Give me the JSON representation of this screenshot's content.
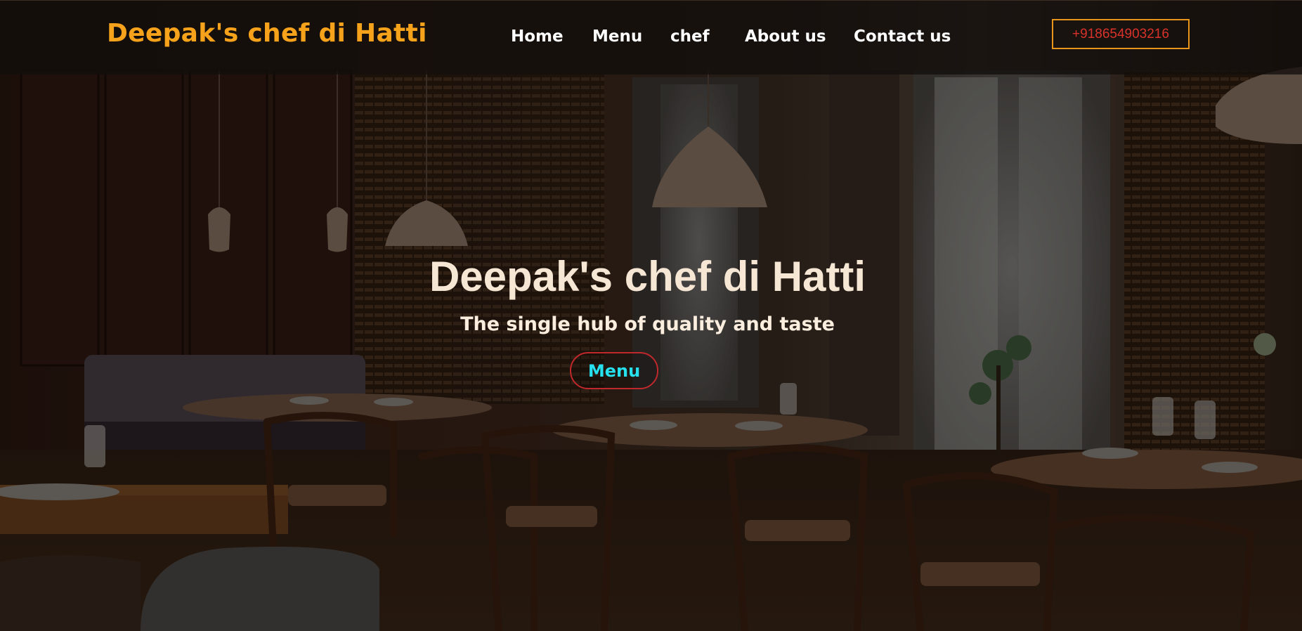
{
  "header": {
    "brand": "Deepak's chef di Hatti",
    "nav": [
      {
        "label": "Home"
      },
      {
        "label": "Menu"
      },
      {
        "label": "chef"
      },
      {
        "label": "About us"
      },
      {
        "label": "Contact us"
      }
    ],
    "phone": "+918654903216"
  },
  "hero": {
    "title": "Deepak's chef di Hatti",
    "subtitle": "The single hub of quality and taste",
    "button_label": "Menu"
  },
  "background": {
    "description_icon": "restaurant-interior-photo"
  },
  "colors": {
    "brand": "#f7a21b",
    "nav_text": "#ffffff",
    "phone_border": "#e7961b",
    "phone_text": "#d8322a",
    "hero_text": "#f6e6d4",
    "button_border": "#c0282c",
    "button_text": "#27e0ee"
  }
}
